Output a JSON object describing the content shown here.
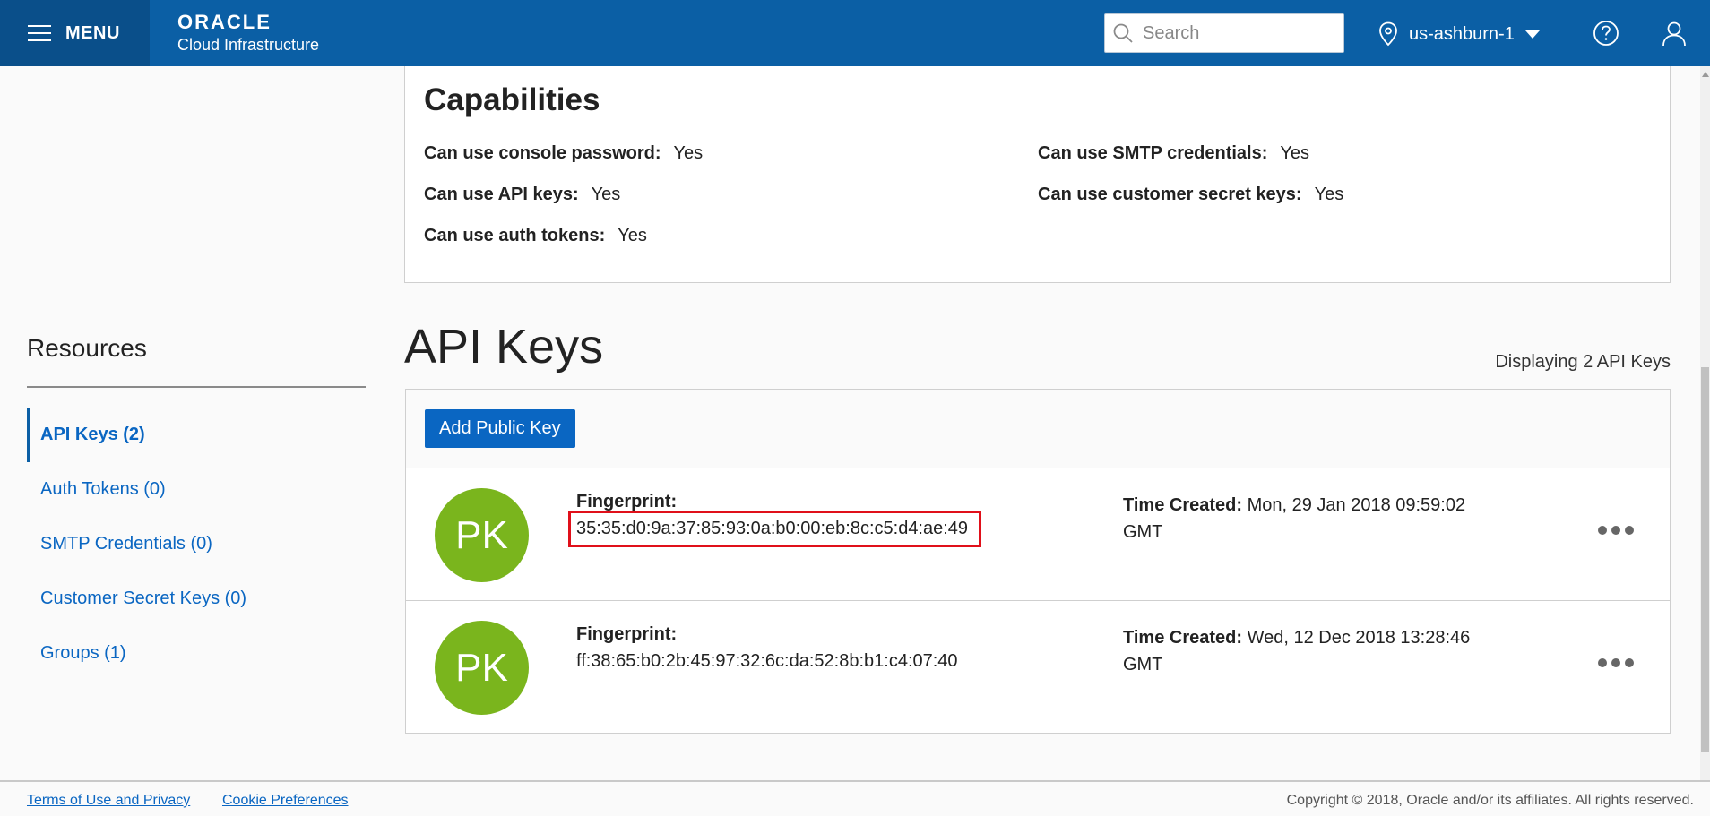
{
  "header": {
    "menu_label": "MENU",
    "brand_name": "ORACLE",
    "brand_product": "Cloud Infrastructure",
    "search_placeholder": "Search",
    "region": "us-ashburn-1"
  },
  "capabilities": {
    "title": "Capabilities",
    "items": [
      {
        "label": "Can use console password:",
        "value": "Yes"
      },
      {
        "label": "Can use SMTP credentials:",
        "value": "Yes"
      },
      {
        "label": "Can use API keys:",
        "value": "Yes"
      },
      {
        "label": "Can use customer secret keys:",
        "value": "Yes"
      },
      {
        "label": "Can use auth tokens:",
        "value": "Yes"
      }
    ]
  },
  "resources": {
    "title": "Resources",
    "items": [
      {
        "label": "API Keys (2)",
        "active": true
      },
      {
        "label": "Auth Tokens (0)",
        "active": false
      },
      {
        "label": "SMTP Credentials (0)",
        "active": false
      },
      {
        "label": "Customer Secret Keys (0)",
        "active": false
      },
      {
        "label": "Groups (1)",
        "active": false
      }
    ]
  },
  "api_keys": {
    "title": "API Keys",
    "count_label": "Displaying 2 API Keys",
    "add_button": "Add Public Key",
    "rows": [
      {
        "avatar": "PK",
        "fingerprint_label": "Fingerprint:",
        "fingerprint": "35:35:d0:9a:37:85:93:0a:b0:00:eb:8c:c5:d4:ae:49",
        "time_label": "Time Created:",
        "time_created": "Mon, 29 Jan 2018 09:59:02 GMT",
        "highlighted": true
      },
      {
        "avatar": "PK",
        "fingerprint_label": "Fingerprint:",
        "fingerprint": "ff:38:65:b0:2b:45:97:32:6c:da:52:8b:b1:c4:07:40",
        "time_label": "Time Created:",
        "time_created": "Wed, 12 Dec 2018 13:28:46 GMT",
        "highlighted": false
      }
    ]
  },
  "footer": {
    "terms": "Terms of Use and Privacy",
    "cookies": "Cookie Preferences",
    "copyright": "Copyright © 2018, Oracle and/or its affiliates. All rights reserved."
  },
  "colors": {
    "header_bg": "#0b5fa5",
    "link": "#0a66c2",
    "avatar_bg": "#7ab51d",
    "highlight_outline": "#e0101a"
  }
}
